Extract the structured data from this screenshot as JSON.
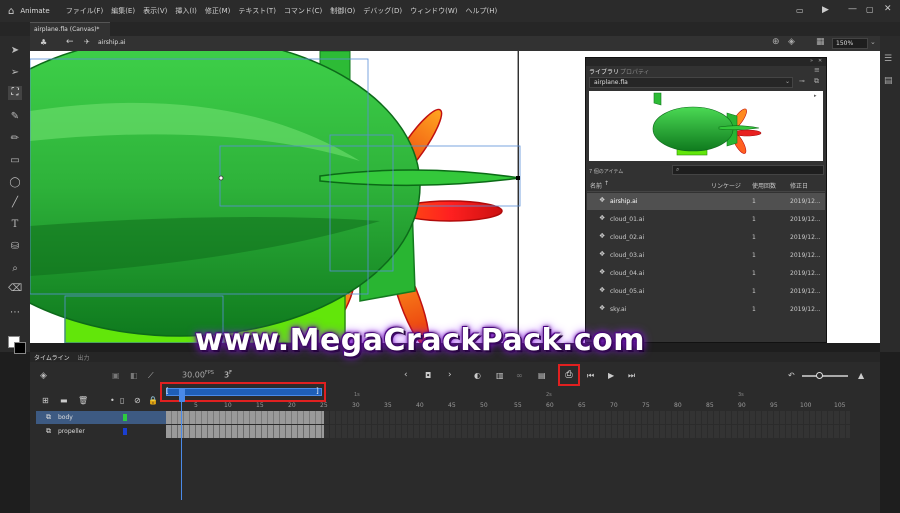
{
  "app": {
    "name": "Animate"
  },
  "menu": [
    "ファイル(F)",
    "編集(E)",
    "表示(V)",
    "挿入(I)",
    "修正(M)",
    "テキスト(T)",
    "コマンド(C)",
    "制御(O)",
    "デバッグ(D)",
    "ウィンドウ(W)",
    "ヘルプ(H)"
  ],
  "document": {
    "tab_title": "airplane.fla (Canvas)*",
    "symbol_name": "airship.ai",
    "zoom": "150%"
  },
  "library": {
    "tabs": [
      "ライブラリ",
      "プロパティ"
    ],
    "file_select": "airplane.fla",
    "item_count": "7 個のアイテム",
    "columns": [
      "名前",
      "リンケージ",
      "使用回数",
      "修正日"
    ],
    "items": [
      {
        "name": "airship.ai",
        "uses": "1",
        "date": "2019/12..."
      },
      {
        "name": "cloud_01.ai",
        "uses": "1",
        "date": "2019/12..."
      },
      {
        "name": "cloud_02.ai",
        "uses": "1",
        "date": "2019/12..."
      },
      {
        "name": "cloud_03.ai",
        "uses": "1",
        "date": "2019/12..."
      },
      {
        "name": "cloud_04.ai",
        "uses": "1",
        "date": "2019/12..."
      },
      {
        "name": "cloud_05.ai",
        "uses": "1",
        "date": "2019/12..."
      },
      {
        "name": "sky.ai",
        "uses": "1",
        "date": "2019/12..."
      }
    ]
  },
  "timeline": {
    "tabs": [
      "タイムライン",
      "出力"
    ],
    "fps": "30.00",
    "fps_unit": "FPS",
    "frame": "3",
    "frame_unit": "F",
    "layers": [
      "body",
      "propeller"
    ],
    "ruler": [
      "5",
      "10",
      "15",
      "20",
      "25",
      "30",
      "35",
      "40",
      "45",
      "50",
      "55",
      "60",
      "65",
      "70",
      "75",
      "80",
      "85",
      "90",
      "95",
      "100",
      "105"
    ],
    "seconds": [
      "1s",
      "2s",
      "3s"
    ]
  },
  "watermark": "www.MegaCrackPack.com",
  "colors": {
    "accent": "#1473e6",
    "highlight_box": "#e02020",
    "green": "#2ecc40",
    "red": "#e8231a"
  }
}
